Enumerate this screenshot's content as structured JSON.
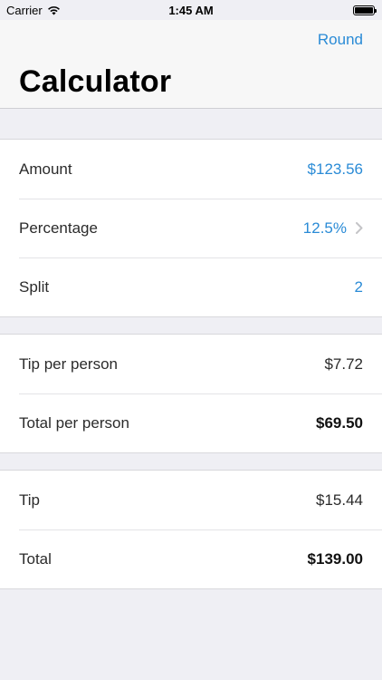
{
  "status_bar": {
    "carrier": "Carrier",
    "time": "1:45 AM",
    "icons": [
      "wifi-icon",
      "battery-icon"
    ]
  },
  "nav": {
    "action_label": "Round",
    "title": "Calculator"
  },
  "inputs": [
    {
      "label": "Amount",
      "value": "$123.56"
    },
    {
      "label": "Percentage",
      "value": "12.5%"
    },
    {
      "label": "Split",
      "value": "2"
    }
  ],
  "per_person": [
    {
      "label": "Tip per person",
      "value": "$7.72"
    },
    {
      "label": "Total per person",
      "value": "$69.50"
    }
  ],
  "totals": [
    {
      "label": "Tip",
      "value": "$15.44"
    },
    {
      "label": "Total",
      "value": "$139.00"
    }
  ],
  "colors": {
    "accent": "#2a8bd6",
    "background": "#efeff4"
  }
}
